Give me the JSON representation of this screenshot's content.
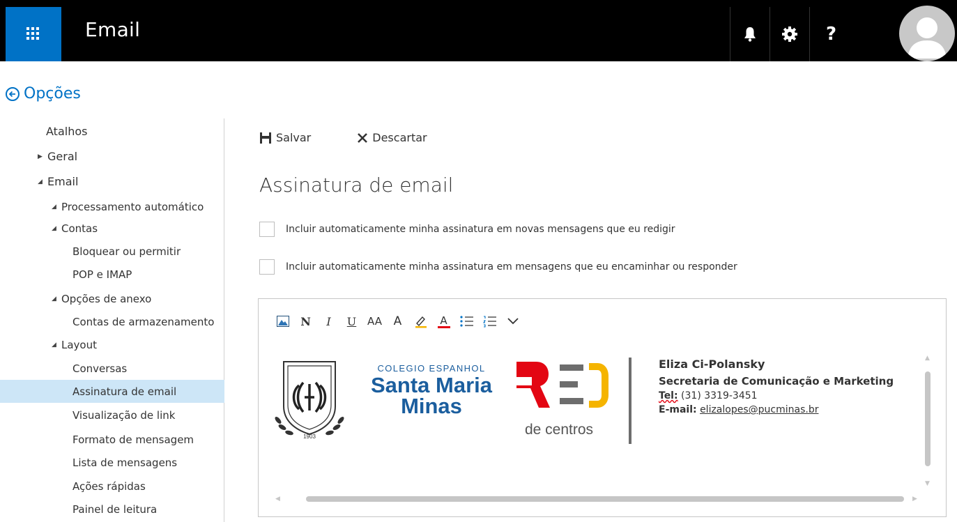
{
  "app": {
    "title": "Email"
  },
  "header": {
    "icons": [
      "waffle-icon",
      "bell-icon",
      "gear-icon",
      "help-icon",
      "avatar"
    ],
    "help_label": "?"
  },
  "options": {
    "title": "Opções"
  },
  "sidebar": {
    "items": [
      {
        "label": "Atalhos"
      },
      {
        "label": "Geral"
      },
      {
        "label": "Email"
      },
      {
        "label": "Processamento automático"
      },
      {
        "label": "Contas"
      },
      {
        "label": "Bloquear ou permitir"
      },
      {
        "label": "POP e IMAP"
      },
      {
        "label": "Opções de anexo"
      },
      {
        "label": "Contas de armazenamento"
      },
      {
        "label": "Layout"
      },
      {
        "label": "Conversas"
      },
      {
        "label": "Assinatura de email"
      },
      {
        "label": "Visualização de link"
      },
      {
        "label": "Formato de mensagem"
      },
      {
        "label": "Lista de mensagens"
      },
      {
        "label": "Ações rápidas"
      },
      {
        "label": "Painel de leitura"
      }
    ]
  },
  "toolbar": {
    "save_label": "Salvar",
    "discard_label": "Descartar"
  },
  "page": {
    "heading": "Assinatura de email"
  },
  "checkboxes": [
    {
      "label": "Incluir automaticamente minha assinatura em novas mensagens que eu redigir",
      "checked": false
    },
    {
      "label": "Incluir automaticamente minha assinatura em mensagens que eu encaminhar ou responder",
      "checked": false
    }
  ],
  "editor": {
    "format_buttons": [
      "insert-image",
      "bold",
      "italic",
      "underline",
      "font-size",
      "grow-font",
      "highlight",
      "font-color",
      "bullets",
      "numbering",
      "more"
    ],
    "bold_glyph": "N",
    "italic_glyph": "I",
    "underline_glyph": "U",
    "font_size_glyph": "AA",
    "grow_font_glyph": "A",
    "font_color_glyph": "A"
  },
  "signature": {
    "school_small": "COLEGIO ESPANHOL",
    "school_name_1": "Santa Maria",
    "school_name_2": "Minas",
    "year": "1903",
    "red_text": "de centros",
    "name": "Eliza Ci-Polansky",
    "role": "Secretaria de Comunicação e Marketing",
    "tel_label": "Tel:",
    "tel_value": "(31) 3319-3451",
    "email_label": "E-mail:",
    "email_value": "elizalopes@pucminas.br"
  },
  "colors": {
    "accent": "#0072c6",
    "topbar": "#000000",
    "selected": "#cde6f7",
    "school_blue": "#1b5e9e",
    "red": "#e30613",
    "yellow": "#f5b400",
    "gray_bar": "#6d6d6d"
  }
}
